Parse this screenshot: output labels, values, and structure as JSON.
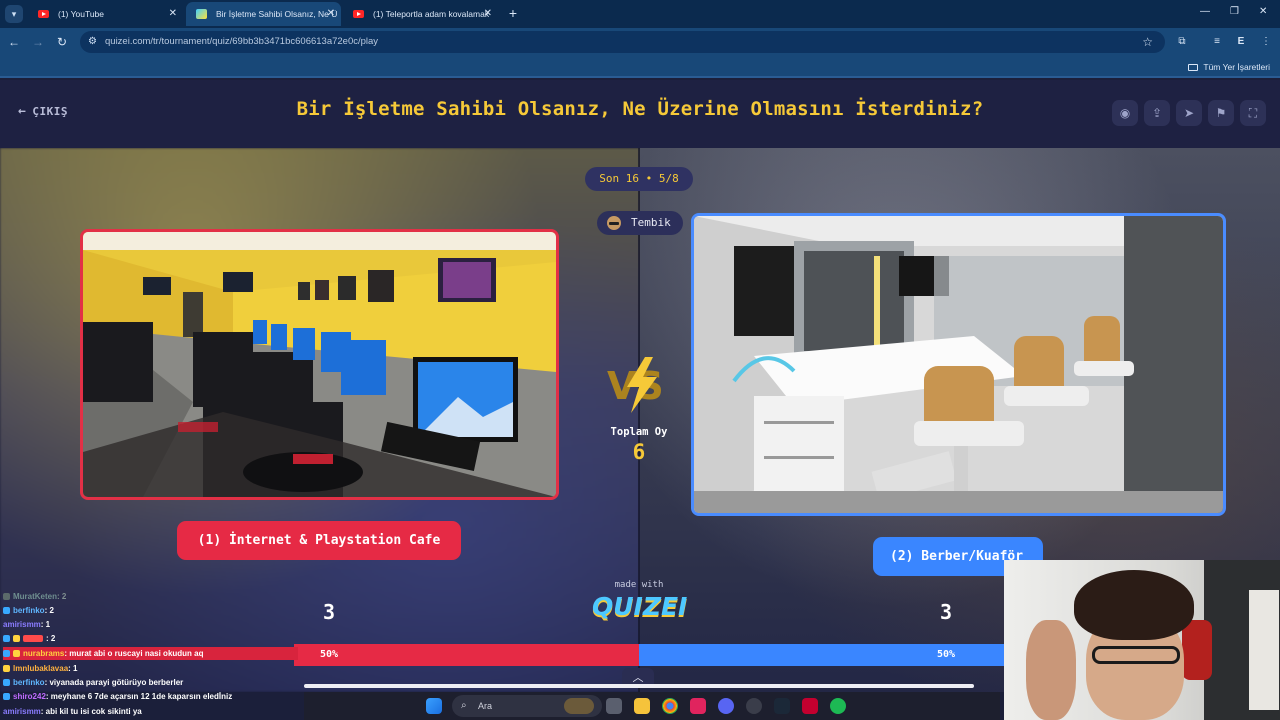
{
  "browser": {
    "tabs": [
      {
        "label": "(1) YouTube",
        "active": false
      },
      {
        "label": "Bir İşletme Sahibi Olsanız, Ne Ü",
        "active": true
      },
      {
        "label": "(1) Teleportla adam kovalamak",
        "active": false
      }
    ],
    "url": "quizei.com/tr/tournament/quiz/69bb3b3471bc606613a72e0c/play",
    "bookmarks_label": "Tüm Yer İşaretleri",
    "profile_letter": "E"
  },
  "quiz": {
    "exit_label": "ÇIKIŞ",
    "title": "Bir İşletme Sahibi Olsanız, Ne Üzerine Olmasını İsterdiniz?",
    "round": "Son 16 • 5/8",
    "user": "Tembik",
    "vs_label": "VS",
    "total_label": "Toplam Oy",
    "total_votes": "6",
    "option1": {
      "label": "(1) İnternet & Playstation Cafe",
      "votes": "3",
      "percent": "50%",
      "color": "#e62a45"
    },
    "option2": {
      "label": "(2) Berber/Kuaför",
      "votes": "3",
      "percent": "50%",
      "color": "#3a86ff"
    },
    "made_with": "made with",
    "brand": "QUIZEI"
  },
  "chat": [
    {
      "user": "MuratKeten",
      "msg": ": 2",
      "color": "#6f8f8f"
    },
    {
      "user": "berfinko",
      "msg": ": 2",
      "color": "#5fb7ff"
    },
    {
      "user": "amirismm",
      "msg": ": 1",
      "color": "#8a7cff"
    },
    {
      "user": "",
      "msg": ": 2",
      "color": "#ff4b4b"
    },
    {
      "user": "nurabrams",
      "msg": ": murat abi o ruscayi nasi okudun aq",
      "color": "#ffd23f",
      "highlight": true
    },
    {
      "user": "lmnlubaklavaa",
      "msg": ": 1",
      "color": "#ffb23f"
    },
    {
      "user": "berfinko",
      "msg": ": viyanada parayi götürüyo berberler",
      "color": "#5fb7ff"
    },
    {
      "user": "shiro242",
      "msg": ": meyhane 6 7de açarsın 12 1de kaparsın eledİniz",
      "color": "#c06bff"
    },
    {
      "user": "amirismm",
      "msg": ": abi kil tu isi cok sikinti ya",
      "color": "#8a7cff"
    }
  ],
  "taskbar": {
    "search_label": "Ara"
  }
}
